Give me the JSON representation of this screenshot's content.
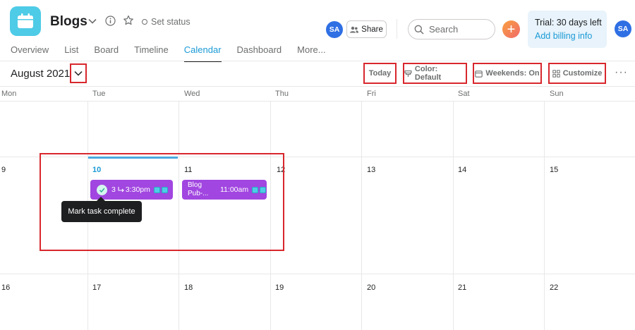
{
  "header": {
    "project_title": "Blogs",
    "set_status": "Set status",
    "avatar_initials": "SA",
    "share_label": "Share",
    "search_placeholder": "Search",
    "plus_label": "+",
    "trial_text": "Trial: 30 days left",
    "billing_link": "Add billing info",
    "user_avatar_initials": "SA"
  },
  "nav": {
    "tabs": [
      {
        "label": "Overview"
      },
      {
        "label": "List"
      },
      {
        "label": "Board"
      },
      {
        "label": "Timeline"
      },
      {
        "label": "Calendar",
        "active": true
      },
      {
        "label": "Dashboard"
      },
      {
        "label": "More..."
      }
    ]
  },
  "toolbar": {
    "month": "August 2021",
    "today_label": "Today",
    "color_label": "Color: Default",
    "weekends_label": "Weekends: On",
    "customize_label": "Customize",
    "more_label": "···"
  },
  "calendar": {
    "weekdays": [
      "Mon",
      "Tue",
      "Wed",
      "Thu",
      "Fri",
      "Sat",
      "Sun"
    ],
    "week2": [
      "9",
      "10",
      "11",
      "12",
      "13",
      "14",
      "15"
    ],
    "week3": [
      "16",
      "17",
      "18",
      "19",
      "20",
      "21",
      "22"
    ],
    "today_date": "10"
  },
  "tasks": [
    {
      "name": "3",
      "time": "3:30pm"
    },
    {
      "name": "Blog Pub-...",
      "time": "11:00am"
    }
  ],
  "tooltip": "Mark task complete",
  "colors": {
    "accent": "#1a9ad6",
    "task": "#a146e0",
    "project_icon": "#4ecbe6",
    "highlight": "#d8272d"
  }
}
